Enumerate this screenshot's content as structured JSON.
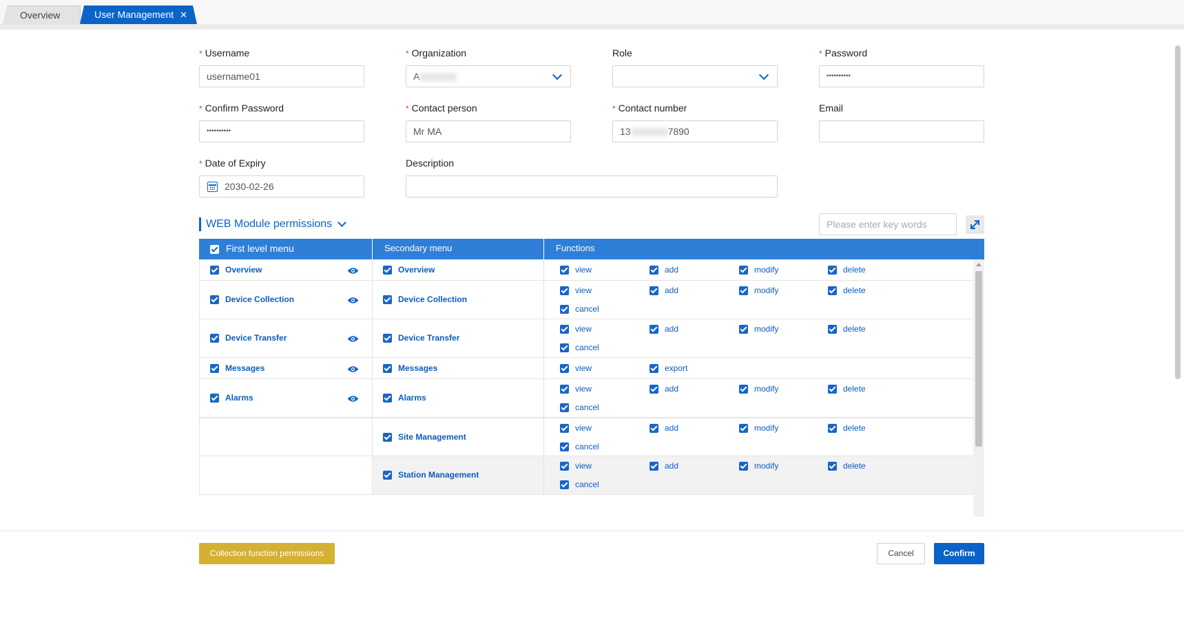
{
  "tabs": [
    {
      "label": "Overview",
      "active": false
    },
    {
      "label": "User Management",
      "active": true,
      "close_glyph": "✕"
    }
  ],
  "form": {
    "username": {
      "label": "Username",
      "required": "*",
      "value": "username01"
    },
    "organization": {
      "label": "Organization",
      "required": "*",
      "value": "A"
    },
    "role": {
      "label": "Role",
      "value": ""
    },
    "password": {
      "label": "Password",
      "required": "*",
      "value": "••••••••••"
    },
    "confirm_password": {
      "label": "Confirm Password",
      "required": "*",
      "value": "••••••••••"
    },
    "contact_person": {
      "label": "Contact person",
      "required": "*",
      "value": "Mr MA"
    },
    "contact_number": {
      "label": "Contact number",
      "required": "*",
      "value_prefix": "13",
      "value_suffix": "7890"
    },
    "email": {
      "label": "Email",
      "value": ""
    },
    "date_of_expiry": {
      "label": "Date of Expiry",
      "required": "*",
      "value": "2030-02-26"
    },
    "description": {
      "label": "Description",
      "value": ""
    }
  },
  "permissions": {
    "title": "WEB Module permissions",
    "search_placeholder": "Please enter key words",
    "headers": {
      "first": "First level menu",
      "second": "Secondary menu",
      "functions": "Functions"
    },
    "rows": [
      {
        "first": "Overview",
        "second": "Overview",
        "functions": [
          "view",
          "add",
          "modify",
          "delete"
        ]
      },
      {
        "first": "Device Collection",
        "second": "Device Collection",
        "functions": [
          "view",
          "add",
          "modify",
          "delete",
          "cancel"
        ]
      },
      {
        "first": "Device Transfer",
        "second": "Device Transfer",
        "functions": [
          "view",
          "add",
          "modify",
          "delete",
          "cancel"
        ]
      },
      {
        "first": "Messages",
        "second": "Messages",
        "functions": [
          "view",
          "export"
        ]
      },
      {
        "first": "Alarms",
        "second": "Alarms",
        "functions": [
          "view",
          "add",
          "modify",
          "delete",
          "cancel"
        ]
      },
      {
        "first": "",
        "second": "Site Management",
        "functions": [
          "view",
          "add",
          "modify",
          "delete",
          "cancel"
        ]
      },
      {
        "first": "",
        "second": "Station Management",
        "functions": [
          "view",
          "add",
          "modify",
          "delete",
          "cancel"
        ]
      }
    ]
  },
  "buttons": {
    "collection": "Collection function permissions",
    "cancel": "Cancel",
    "confirm": "Confirm"
  },
  "colors": {
    "accent": "#0b63c7",
    "header": "#2f7fd8",
    "collect_button": "#d4b033",
    "required": "#e23b3b"
  }
}
